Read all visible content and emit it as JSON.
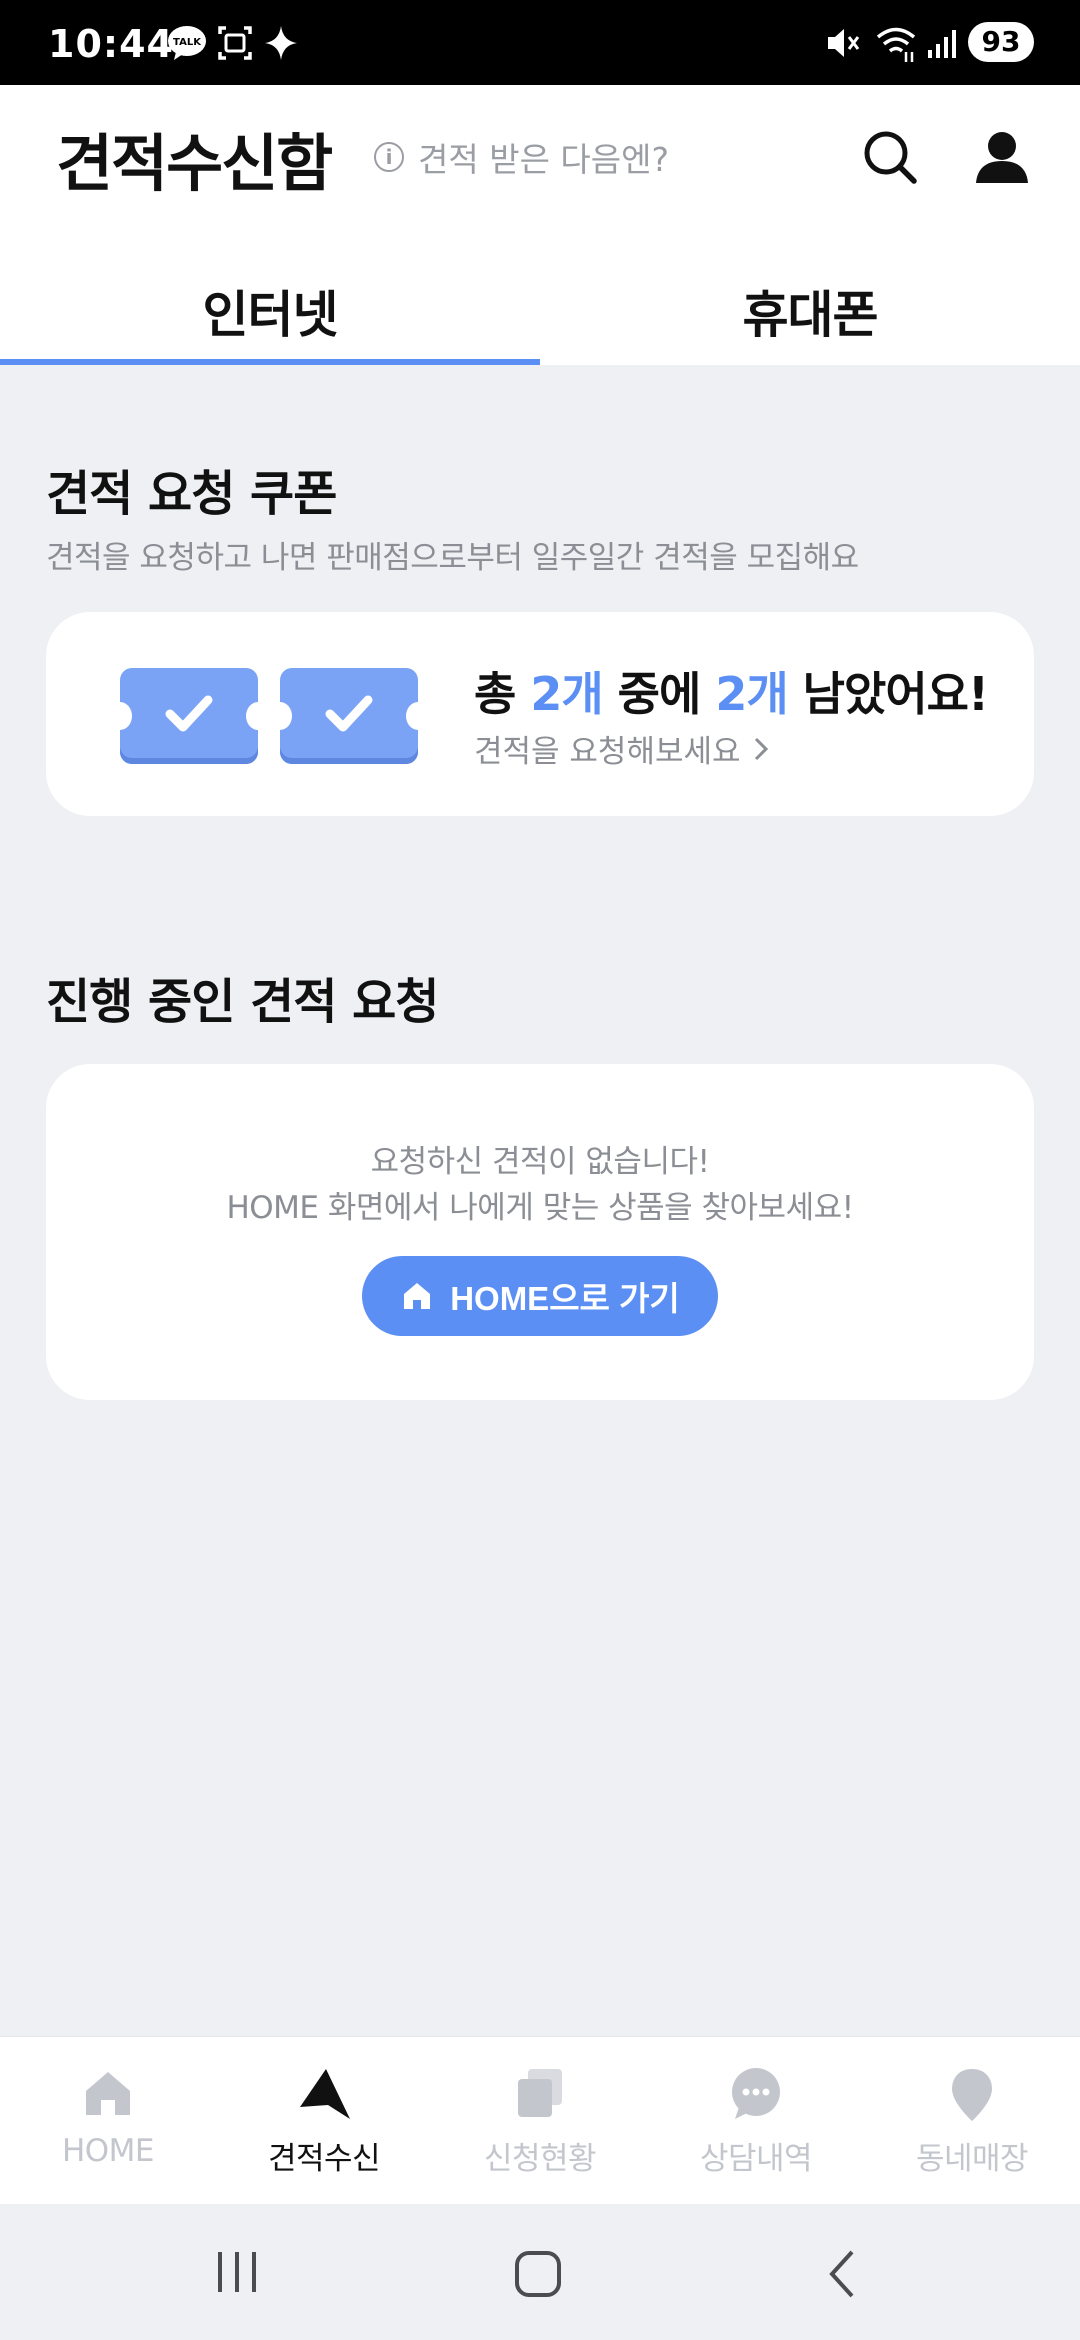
{
  "status_bar": {
    "time": "10:44",
    "battery": "93",
    "icons": [
      "talk-icon",
      "screen-capture-icon",
      "sparkle-icon",
      "mute-icon",
      "wifi-icon",
      "signal-icon"
    ]
  },
  "header": {
    "title": "견적수신함",
    "help_text": "견적 받은 다음엔?",
    "help_icon": "info-icon",
    "search_icon": "search-icon",
    "profile_icon": "user-icon"
  },
  "tabs": [
    {
      "label": "인터넷",
      "active": true
    },
    {
      "label": "휴대폰",
      "active": false
    }
  ],
  "coupon_section": {
    "title": "견적 요청 쿠폰",
    "subtitle": "견적을 요청하고 나면 판매점으로부터 일주일간 견적을 모집해요",
    "text_prefix": "총 ",
    "total": "2개",
    "text_mid": " 중에 ",
    "remaining": "2개",
    "text_suffix": " 남았어요!",
    "link_label": "견적을 요청해보세요",
    "ticket_icon": "ticket-check-icon"
  },
  "progress_section": {
    "title": "진행 중인 견적 요청",
    "empty_line1": "요청하신 견적이 없습니다!",
    "empty_line2": "HOME 화면에서 나에게 맞는 상품을 찾아보세요!",
    "button_label": "HOME으로 가기",
    "button_icon": "home-icon"
  },
  "bottom_nav": [
    {
      "label": "HOME",
      "icon": "home-icon",
      "active": false
    },
    {
      "label": "견적수신",
      "icon": "send-icon",
      "active": true
    },
    {
      "label": "신청현황",
      "icon": "documents-icon",
      "active": false
    },
    {
      "label": "상담내역",
      "icon": "chat-icon",
      "active": false
    },
    {
      "label": "동네매장",
      "icon": "location-pin-icon",
      "active": false
    }
  ],
  "colors": {
    "accent": "#5b8ff4",
    "background": "#eef0f4",
    "muted_text": "#8b8e94"
  }
}
